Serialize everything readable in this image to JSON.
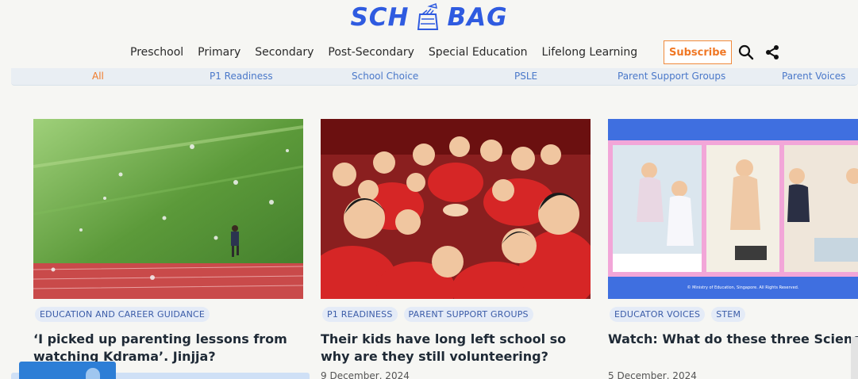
{
  "logo": {
    "left": "SCH",
    "right": "BAG"
  },
  "nav": {
    "items": [
      "Preschool",
      "Primary",
      "Secondary",
      "Post-Secondary",
      "Special Education",
      "Lifelong Learning"
    ],
    "subscribe": "Subscribe"
  },
  "categories": [
    "All",
    "P1 Readiness",
    "School Choice",
    "PSLE",
    "Parent Support Groups",
    "Parent Voices"
  ],
  "articles": [
    {
      "tags": [
        "EDUCATION AND CAREER GUIDANCE"
      ],
      "title": "‘I picked up parenting lessons from watching Kdrama’. Jinjja?",
      "date": ""
    },
    {
      "tags": [
        "P1 READINESS",
        "PARENT SUPPORT GROUPS"
      ],
      "title": "Their kids have long left school so why are they still volunteering?",
      "date": "9 December, 2024"
    },
    {
      "tags": [
        "EDUCATOR VOICES",
        "STEM"
      ],
      "title": "Watch: What do these three Science teache have in common?",
      "date": "5 December, 2024",
      "image_caption": "© Ministry of Education, Singapore. All Rights Reserved."
    }
  ],
  "colors": {
    "brand": "#2f5be0",
    "accent": "#f07826",
    "link": "#4a78c9"
  }
}
